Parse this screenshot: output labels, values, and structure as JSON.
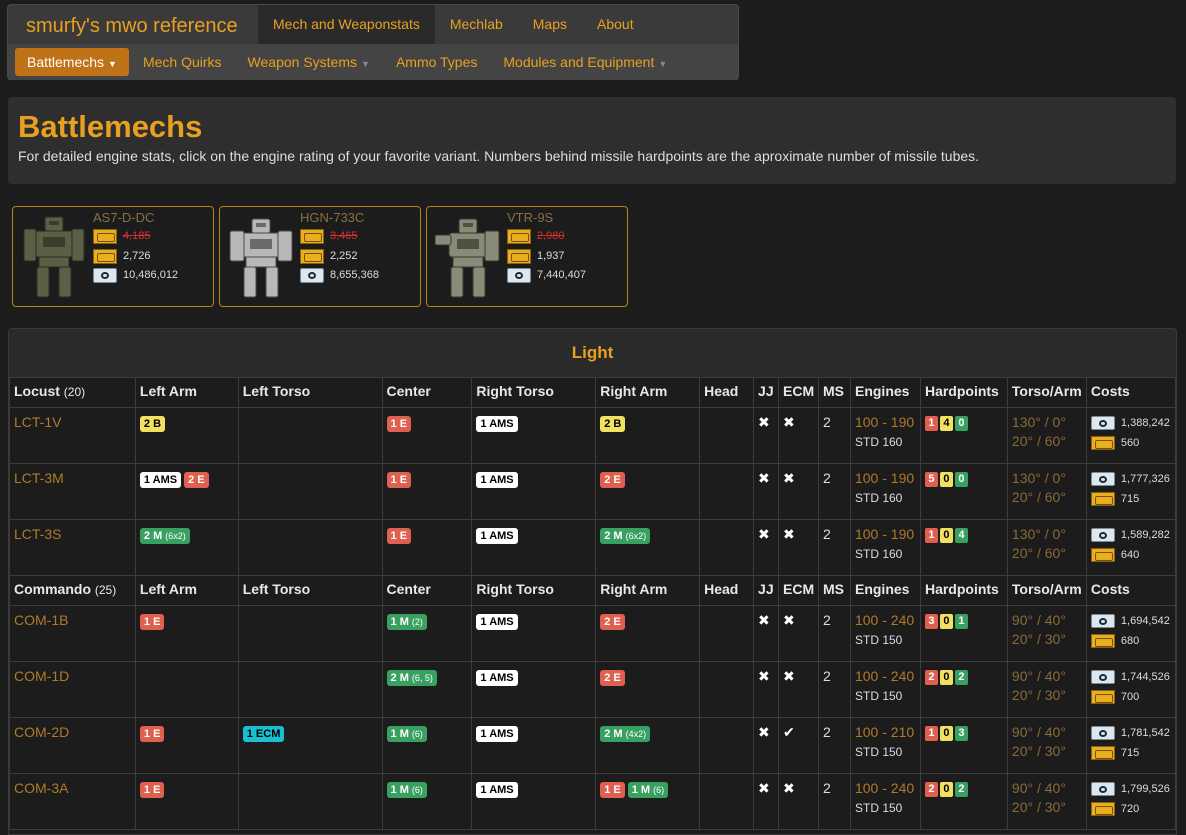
{
  "nav": {
    "brand": "smurfy's mwo reference",
    "top": [
      "Mech and Weaponstats",
      "Mechlab",
      "Maps",
      "About"
    ],
    "sub": [
      {
        "label": "Battlemechs",
        "caret": true
      },
      {
        "label": "Mech Quirks",
        "caret": false
      },
      {
        "label": "Weapon Systems",
        "caret": true
      },
      {
        "label": "Ammo Types",
        "caret": false
      },
      {
        "label": "Modules and Equipment",
        "caret": true
      }
    ]
  },
  "header": {
    "title": "Battlemechs",
    "desc": "For detailed engine stats, click on the engine rating of your favorite variant. Numbers behind missile hardpoints are the aproximate number of missile tubes."
  },
  "featured": [
    {
      "name": "AS7-D-DC",
      "mc_old": "4,185",
      "mc_new": "2,726",
      "cbills": "10,486,012"
    },
    {
      "name": "HGN-733C",
      "mc_old": "3,465",
      "mc_new": "2,252",
      "cbills": "8,655,368"
    },
    {
      "name": "VTR-9S",
      "mc_old": "2,980",
      "mc_new": "1,937",
      "cbills": "7,440,407"
    }
  ],
  "table": {
    "section_title": "Light",
    "columns": [
      "Left Arm",
      "Left Torso",
      "Center",
      "Right Torso",
      "Right Arm",
      "Head",
      "JJ",
      "ECM",
      "MS",
      "Engines",
      "Hardpoints",
      "Torso/Arm",
      "Costs"
    ],
    "groups": [
      {
        "name": "Locust",
        "count": "(20)",
        "rows": [
          {
            "variant": "LCT-1V",
            "la": [
              [
                "y",
                "2 B",
                ""
              ]
            ],
            "lt": [],
            "ct": [
              [
                "r",
                "1 E",
                ""
              ]
            ],
            "rt": [
              [
                "w",
                "1 AMS",
                ""
              ]
            ],
            "ra": [
              [
                "y",
                "2 B",
                ""
              ]
            ],
            "head": [],
            "jj": "✖",
            "ecm": "✖",
            "ms": "2",
            "eng_range": "100 - 190",
            "eng_std": "STD 160",
            "hp": [
              "1",
              "4",
              "0"
            ],
            "torso": "130° / 0°",
            "arm": "20° / 60°",
            "cbills": "1,388,242",
            "mc": "560"
          },
          {
            "variant": "LCT-3M",
            "la": [
              [
                "w",
                "1 AMS",
                ""
              ],
              [
                "r",
                "2 E",
                ""
              ]
            ],
            "lt": [],
            "ct": [
              [
                "r",
                "1 E",
                ""
              ]
            ],
            "rt": [
              [
                "w",
                "1 AMS",
                ""
              ]
            ],
            "ra": [
              [
                "r",
                "2 E",
                ""
              ]
            ],
            "head": [],
            "jj": "✖",
            "ecm": "✖",
            "ms": "2",
            "eng_range": "100 - 190",
            "eng_std": "STD 160",
            "hp": [
              "5",
              "0",
              "0"
            ],
            "torso": "130° / 0°",
            "arm": "20° / 60°",
            "cbills": "1,777,326",
            "mc": "715"
          },
          {
            "variant": "LCT-3S",
            "la": [
              [
                "g",
                "2 M",
                "(6x2)"
              ]
            ],
            "lt": [],
            "ct": [
              [
                "r",
                "1 E",
                ""
              ]
            ],
            "rt": [
              [
                "w",
                "1 AMS",
                ""
              ]
            ],
            "ra": [
              [
                "g",
                "2 M",
                "(6x2)"
              ]
            ],
            "head": [],
            "jj": "✖",
            "ecm": "✖",
            "ms": "2",
            "eng_range": "100 - 190",
            "eng_std": "STD 160",
            "hp": [
              "1",
              "0",
              "4"
            ],
            "torso": "130° / 0°",
            "arm": "20° / 60°",
            "cbills": "1,589,282",
            "mc": "640"
          }
        ]
      },
      {
        "name": "Commando",
        "count": "(25)",
        "rows": [
          {
            "variant": "COM-1B",
            "la": [
              [
                "r",
                "1 E",
                ""
              ]
            ],
            "lt": [],
            "ct": [
              [
                "g",
                "1 M",
                "(2)"
              ]
            ],
            "rt": [
              [
                "w",
                "1 AMS",
                ""
              ]
            ],
            "ra": [
              [
                "r",
                "2 E",
                ""
              ]
            ],
            "head": [],
            "jj": "✖",
            "ecm": "✖",
            "ms": "2",
            "eng_range": "100 - 240",
            "eng_std": "STD 150",
            "hp": [
              "3",
              "0",
              "1"
            ],
            "torso": "90° / 40°",
            "arm": "20° / 30°",
            "cbills": "1,694,542",
            "mc": "680"
          },
          {
            "variant": "COM-1D",
            "la": [],
            "lt": [],
            "ct": [
              [
                "g",
                "2 M",
                "(6, 5)"
              ]
            ],
            "rt": [
              [
                "w",
                "1 AMS",
                ""
              ]
            ],
            "ra": [
              [
                "r",
                "2 E",
                ""
              ]
            ],
            "head": [],
            "jj": "✖",
            "ecm": "✖",
            "ms": "2",
            "eng_range": "100 - 240",
            "eng_std": "STD 150",
            "hp": [
              "2",
              "0",
              "2"
            ],
            "torso": "90° / 40°",
            "arm": "20° / 30°",
            "cbills": "1,744,526",
            "mc": "700"
          },
          {
            "variant": "COM-2D",
            "la": [
              [
                "r",
                "1 E",
                ""
              ]
            ],
            "lt": [
              [
                "c",
                "1 ECM",
                ""
              ]
            ],
            "ct": [
              [
                "g",
                "1 M",
                "(6)"
              ]
            ],
            "rt": [
              [
                "w",
                "1 AMS",
                ""
              ]
            ],
            "ra": [
              [
                "g",
                "2 M",
                "(4x2)"
              ]
            ],
            "head": [],
            "jj": "✖",
            "ecm": "✔",
            "ms": "2",
            "eng_range": "100 - 210",
            "eng_std": "STD 150",
            "hp": [
              "1",
              "0",
              "3"
            ],
            "torso": "90° / 40°",
            "arm": "20° / 30°",
            "cbills": "1,781,542",
            "mc": "715"
          },
          {
            "variant": "COM-3A",
            "la": [
              [
                "r",
                "1 E",
                ""
              ]
            ],
            "lt": [],
            "ct": [
              [
                "g",
                "1 M",
                "(6)"
              ]
            ],
            "rt": [
              [
                "w",
                "1 AMS",
                ""
              ]
            ],
            "ra": [
              [
                "r",
                "1 E",
                ""
              ],
              [
                "g",
                "1 M",
                "(6)"
              ]
            ],
            "head": [],
            "jj": "✖",
            "ecm": "✖",
            "ms": "2",
            "eng_range": "100 - 240",
            "eng_std": "STD 150",
            "hp": [
              "2",
              "0",
              "2"
            ],
            "torso": "90° / 40°",
            "arm": "20° / 30°",
            "cbills": "1,799,526",
            "mc": "720"
          }
        ]
      }
    ]
  }
}
